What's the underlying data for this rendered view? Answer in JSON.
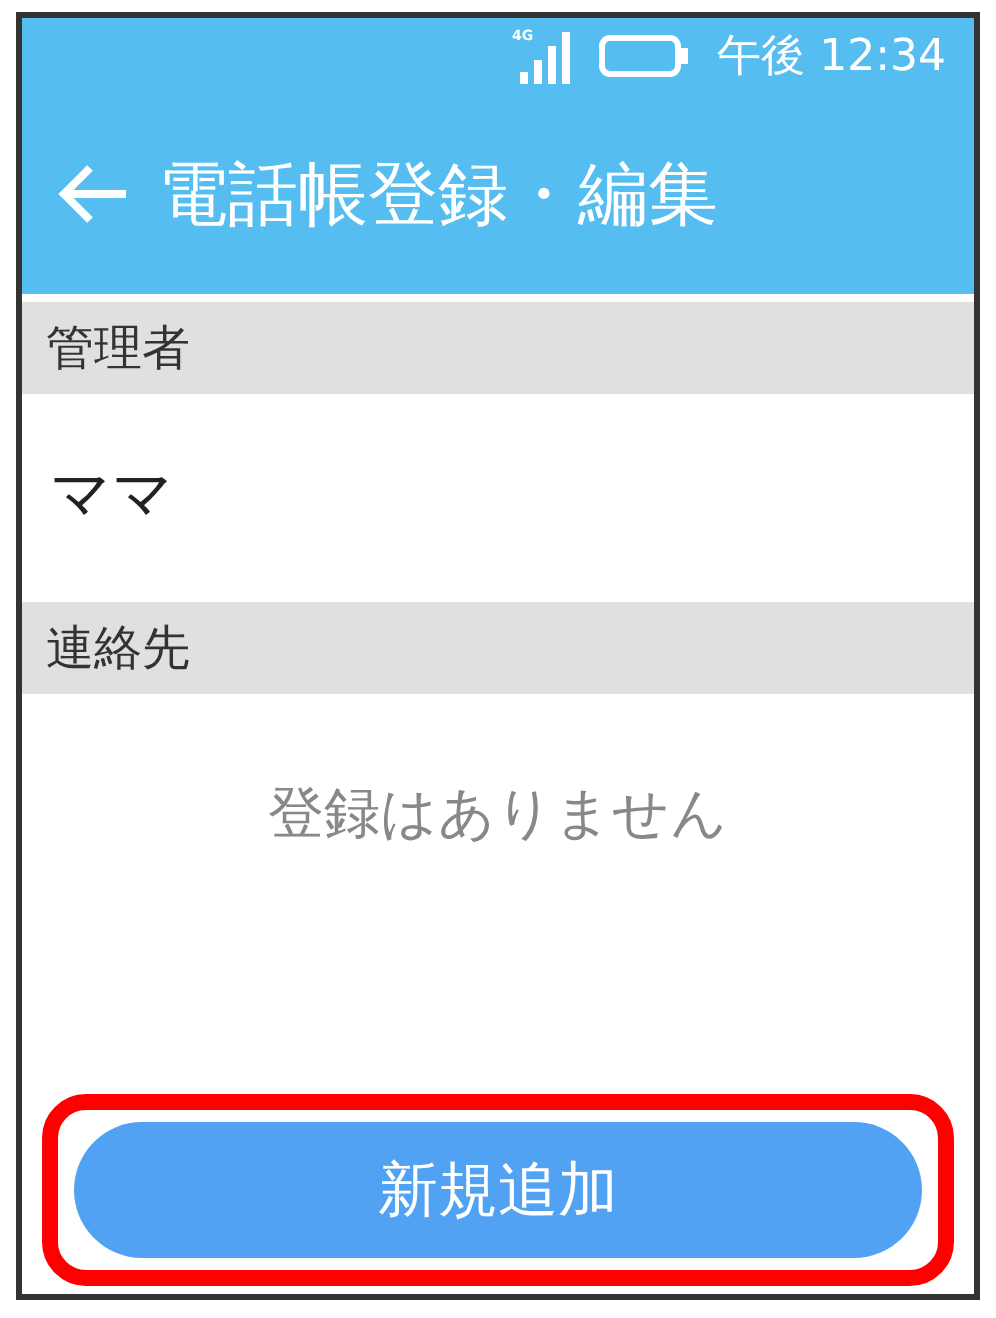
{
  "status_bar": {
    "network": "4G",
    "time": "午後 12:34"
  },
  "header": {
    "title": "電話帳登録・編集"
  },
  "sections": [
    {
      "heading": "管理者",
      "items": [
        "ママ"
      ]
    },
    {
      "heading": "連絡先",
      "empty_message": "登録はありません"
    }
  ],
  "add_button": {
    "label": "新規追加",
    "highlighted": true
  }
}
